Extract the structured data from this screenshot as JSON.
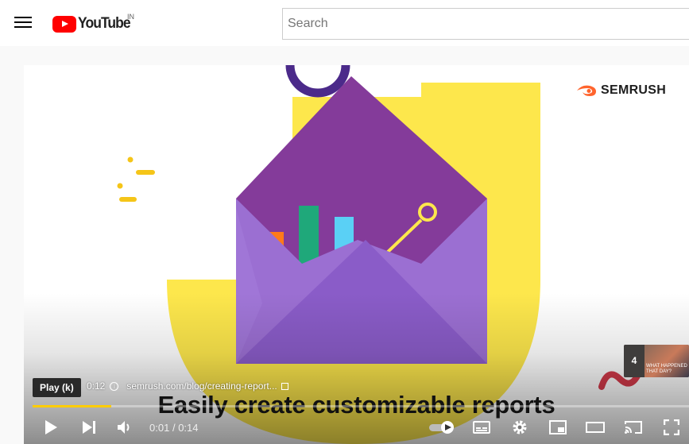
{
  "header": {
    "logo_text": "YouTube",
    "country_code": "IN",
    "search_placeholder": "Search"
  },
  "video": {
    "brand_text": "SEMRUSH",
    "caption": "Easily create customizable reports",
    "tooltip": "Play (k)",
    "card_time": "0:12",
    "card_link": "semrush.com/blog/creating-report...",
    "endcard_count": "4",
    "endcard_text": "WHAT HAPPENED THAT DAY?",
    "current_time": "0:01",
    "separator": "/",
    "duration": "0:14",
    "progress_played": 0.12,
    "progress_loaded": 0.12
  },
  "colors": {
    "accent": "#ffcc00",
    "youtube_red": "#ff0000",
    "envelope_purple": "#8a4fc9",
    "background_yellow": "#fde74c"
  },
  "icons": {
    "menu": "hamburger-menu-icon",
    "play": "play-icon",
    "next": "next-icon",
    "volume": "volume-icon",
    "autoplay": "autoplay-toggle-icon",
    "subtitles": "subtitles-icon",
    "settings": "gear-icon",
    "miniplayer": "miniplayer-icon",
    "theater": "theater-mode-icon",
    "cast": "cast-icon",
    "fullscreen": "fullscreen-icon"
  }
}
